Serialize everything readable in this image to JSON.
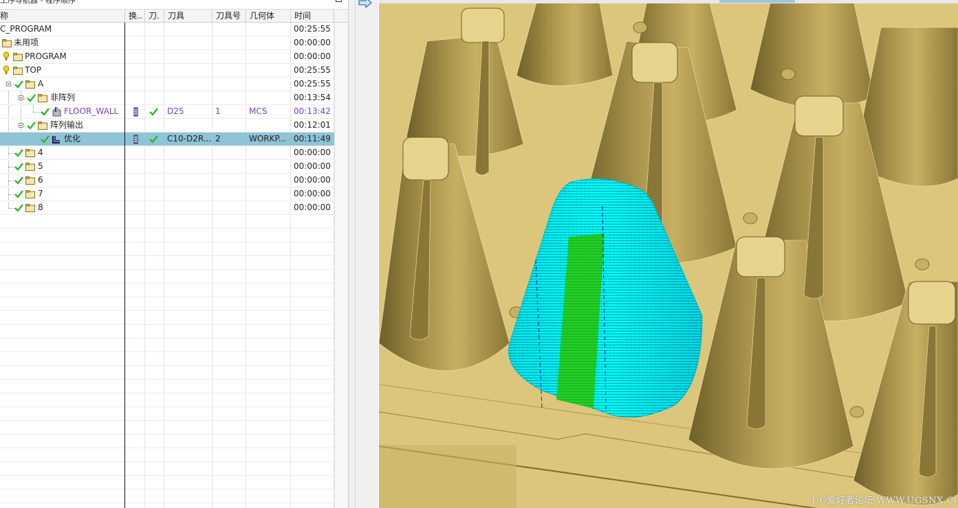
{
  "navigator": {
    "title": "工序导航器 - 程序顺序",
    "columns": [
      "称",
      "换..",
      "刀.",
      "刀具",
      "刀具号",
      "几何体",
      "时间"
    ],
    "rows": [
      {
        "name": "C_PROGRAM",
        "time": "00:25:55"
      },
      {
        "name": "未用项",
        "time": "00:00:00"
      },
      {
        "name": "PROGRAM",
        "time": "00:00:00"
      },
      {
        "name": "TOP",
        "time": "00:25:55"
      },
      {
        "name": "A",
        "time": "00:25:55"
      },
      {
        "name": "非阵列",
        "time": "00:13:54"
      },
      {
        "name": "FLOOR_WALL",
        "tool": "D25",
        "tool_no": "1",
        "geometry": "MCS",
        "time": "00:13:42"
      },
      {
        "name": "阵列输出",
        "time": "00:12:01"
      },
      {
        "name": "优化",
        "tool": "C10-D2R...",
        "tool_no": "2",
        "geometry": "WORKP...",
        "time": "00:11:49"
      },
      {
        "name": "4",
        "time": "00:00:00"
      },
      {
        "name": "5",
        "time": "00:00:00"
      },
      {
        "name": "6",
        "time": "00:00:00"
      },
      {
        "name": "7",
        "time": "00:00:00"
      },
      {
        "name": "8",
        "time": "00:00:00"
      }
    ]
  },
  "colors": {
    "selection": "#8fc3d6",
    "operation_text": "#7a3fc0",
    "check": "#2fb52f",
    "folder": "#d7b24a",
    "part": "#d8c074",
    "toolpath": "#00ffff",
    "tool_shank": "#22d022"
  },
  "icons": [
    "bulb-icon",
    "folder-icon",
    "check-icon",
    "operation-icon",
    "tool-change-icon",
    "arrow-right-icon"
  ],
  "watermark": "UG爱好者论坛 WWW.UGSNX.COM"
}
